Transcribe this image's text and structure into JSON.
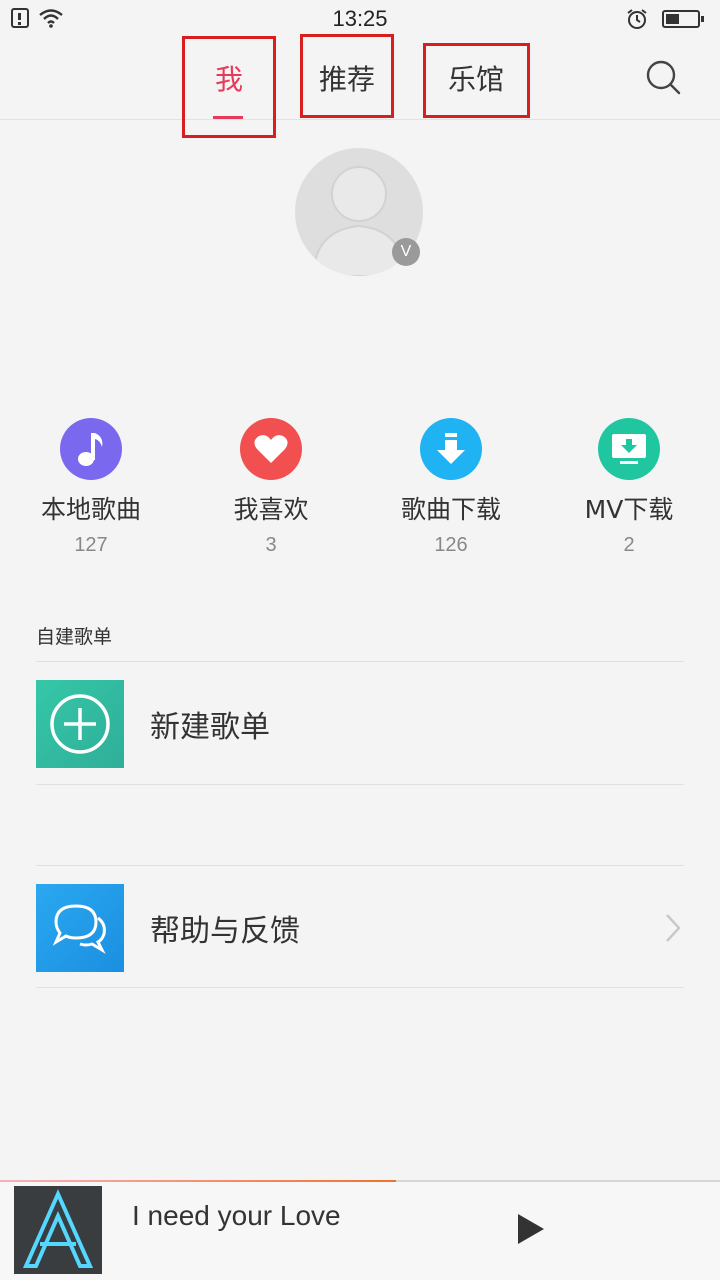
{
  "status": {
    "time": "13:25"
  },
  "tabs": [
    {
      "label": "我",
      "active": true
    },
    {
      "label": "推荐",
      "active": false
    },
    {
      "label": "乐馆",
      "active": false
    }
  ],
  "profile": {
    "vip_label": "V"
  },
  "quick_actions": [
    {
      "label": "本地歌曲",
      "count": "127",
      "icon": "music-note-icon",
      "color": "#7a69ee"
    },
    {
      "label": "我喜欢",
      "count": "3",
      "icon": "heart-icon",
      "color": "#f25050"
    },
    {
      "label": "歌曲下载",
      "count": "126",
      "icon": "download-icon",
      "color": "#1fb3f3"
    },
    {
      "label": "MV下载",
      "count": "2",
      "icon": "mv-download-icon",
      "color": "#1fc6a0"
    }
  ],
  "playlists_section": {
    "label": "自建歌单"
  },
  "rows": {
    "new_playlist": {
      "label": "新建歌单",
      "icon": "plus-circle-icon",
      "color": "#3bbfa3"
    },
    "help": {
      "label": "帮助与反馈",
      "icon": "chat-bubbles-icon",
      "color": "#1e9be8"
    }
  },
  "player": {
    "title": "I need your Love",
    "progress": 0.55
  },
  "colors": {
    "accent": "#e8395c",
    "annotation": "#d81e1e"
  }
}
